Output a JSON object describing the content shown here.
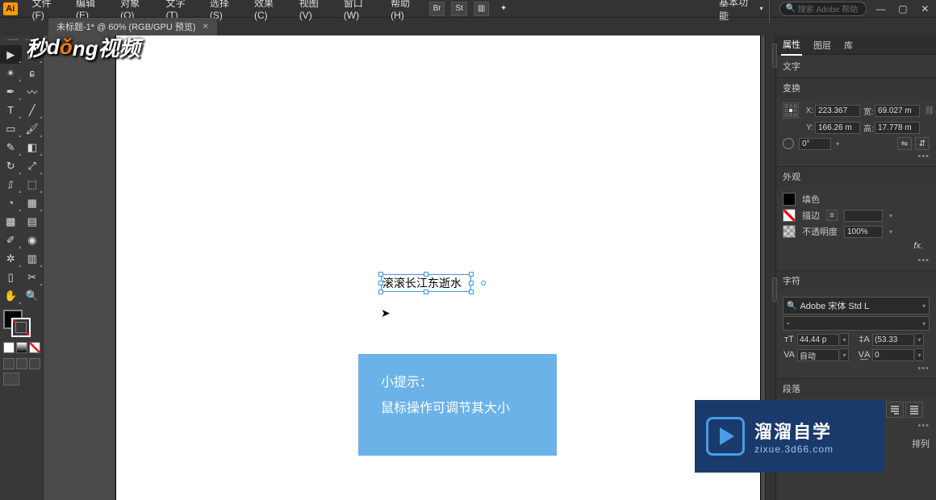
{
  "menu": {
    "items": [
      "文件(F)",
      "编辑(E)",
      "对象(O)",
      "文字(T)",
      "选择(S)",
      "效果(C)",
      "视图(V)",
      "窗口(W)",
      "帮助(H)"
    ],
    "icon_btns": [
      "Br",
      "St"
    ],
    "workspace": "基本功能",
    "search_placeholder": "搜索 Adobe 帮助"
  },
  "tab": {
    "title": "未标题-1* @ 60% (RGB/GPU 预览)"
  },
  "watermark": "秒dǒng视频",
  "canvas": {
    "selected_text": "滚滚长江东逝水",
    "tip_title": "小提示：",
    "tip_body": "鼠标操作可调节其大小"
  },
  "panels": {
    "tabs": [
      "属性",
      "图层",
      "库"
    ],
    "type_label": "文字",
    "transform": {
      "title": "变换",
      "x": "223.367",
      "w": "69.027 m",
      "y": "166.26 m",
      "h": "17.778 m",
      "rotate": "0°"
    },
    "appearance": {
      "title": "外观",
      "fill_label": "填色",
      "stroke_label": "描边",
      "stroke_width": "",
      "opacity_label": "不透明度",
      "opacity_value": "100%",
      "fx": "fx."
    },
    "character": {
      "title": "字符",
      "font": "Adobe 宋体 Std L",
      "style": "-",
      "size": "44.44 p",
      "leading": "(53.33",
      "kerning": "自动",
      "tracking": "0"
    },
    "paragraph": {
      "title": "段落",
      "footer": "排列"
    }
  },
  "brand": {
    "name": "溜溜自学",
    "url": "zixue.3d66.com"
  }
}
